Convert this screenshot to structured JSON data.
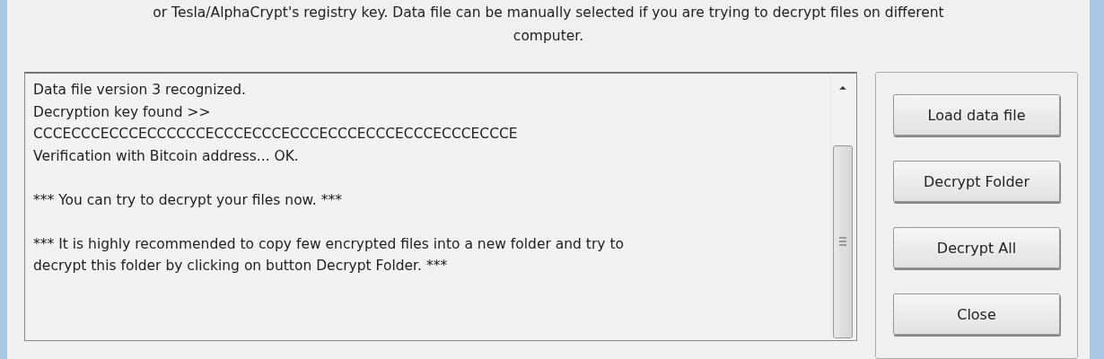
{
  "intro": {
    "lines": [
      "or Tesla/AlphaCrypt's registry key. Data file can be manually selected if you are trying to decrypt files on different",
      "computer."
    ]
  },
  "log": {
    "paragraphs": [
      [
        "Data file version 3 recognized.",
        "Decryption key found >>",
        "CCCECCCECCCECCCCCCECCCECCCECCCECCCECCCECCCECCCECCCE",
        "Verification with Bitcoin address... OK."
      ],
      [
        "*** You can try to decrypt your files now. ***"
      ],
      [
        "*** It is highly recommended to copy few encrypted files into a new folder and try to",
        "decrypt this folder by clicking on button Decrypt Folder. ***"
      ]
    ]
  },
  "buttons": [
    {
      "label": "Load data file"
    },
    {
      "label": "Decrypt Folder"
    },
    {
      "label": "Decrypt All"
    },
    {
      "label": "Close"
    }
  ]
}
